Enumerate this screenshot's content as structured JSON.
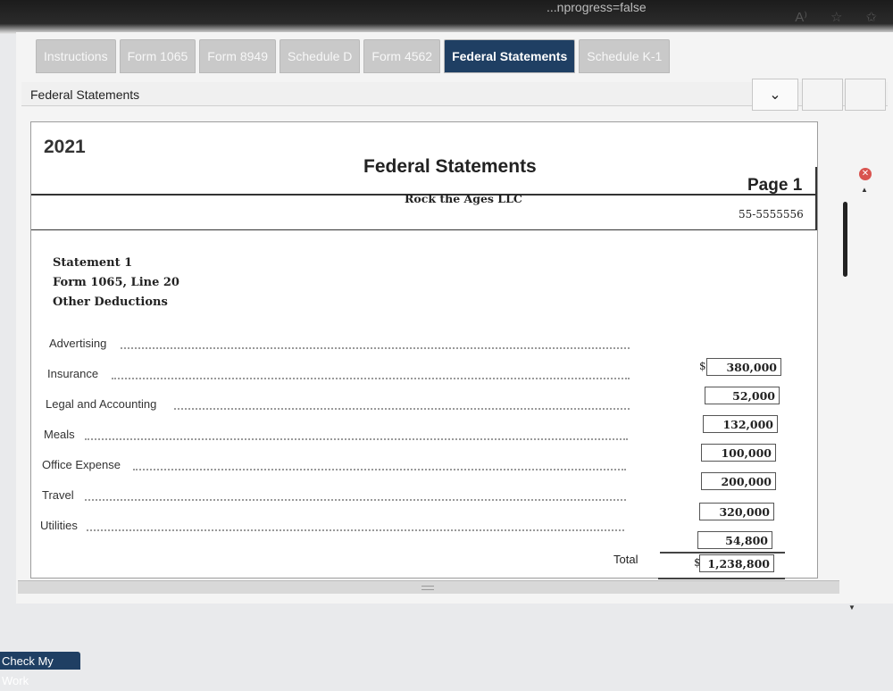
{
  "browser": {
    "url_fragment": "...nprogress=false"
  },
  "tabs": [
    {
      "label": "Instructions"
    },
    {
      "label": "Form 1065"
    },
    {
      "label": "Form 8949"
    },
    {
      "label": "Schedule D"
    },
    {
      "label": "Form 4562"
    },
    {
      "label": "Federal Statements"
    },
    {
      "label": "Schedule K-1"
    }
  ],
  "active_tab": "Federal Statements",
  "header": {
    "label": "Federal Statements",
    "dropdown_icon": "chevron-down-icon"
  },
  "document": {
    "year": "2021",
    "title": "Federal Statements",
    "company": "Rock the Ages LLC",
    "page": "Page 1",
    "ein": "55-5555556",
    "statement": {
      "number": "Statement 1",
      "form": "Form 1065, Line 20",
      "category": "Other Deductions"
    },
    "items": [
      {
        "label": "Advertising",
        "amount": "380,000",
        "dollar": "$"
      },
      {
        "label": "Insurance",
        "amount": "52,000"
      },
      {
        "label": "Legal and Accounting",
        "amount": "132,000"
      },
      {
        "label": "Meals",
        "amount": "100,000"
      },
      {
        "label": "Office Expense",
        "amount": "200,000"
      },
      {
        "label": "Travel",
        "amount": "320,000"
      },
      {
        "label": "Utilities",
        "amount": "54,800"
      }
    ],
    "total": {
      "label": "Total",
      "amount": "1,238,800",
      "dollar": "$"
    }
  },
  "footer": {
    "check_button": "Check My Work"
  },
  "colors": {
    "active_tab": "#1f3f63",
    "close_button": "#d9534f"
  }
}
